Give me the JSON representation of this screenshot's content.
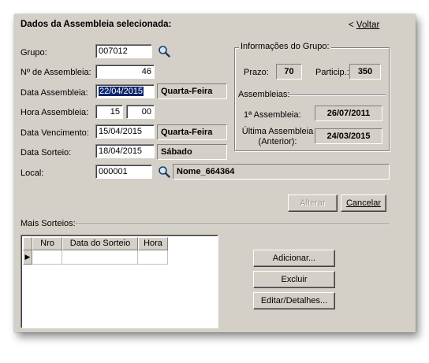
{
  "header": {
    "title": "Dados da Assembleia selecionada:",
    "back_chevron": "<",
    "back_label": "Voltar"
  },
  "form": {
    "grupo": {
      "label": "Grupo:",
      "value": "007012"
    },
    "numero": {
      "label": "Nº de Assembleia:",
      "value": "46"
    },
    "data_assembleia": {
      "label": "Data Assembleia:",
      "value": "22/04/2015",
      "weekday": "Quarta-Feira"
    },
    "hora": {
      "label": "Hora Assembleia:",
      "hour": "15",
      "minute": "00"
    },
    "data_vencimento": {
      "label": "Data Vencimento:",
      "value": "15/04/2015",
      "weekday": "Quarta-Feira"
    },
    "data_sorteio": {
      "label": "Data Sorteio:",
      "value": "18/04/2015",
      "weekday": "Sábado"
    },
    "local": {
      "label": "Local:",
      "value": "000001",
      "name": "Nome_664364"
    }
  },
  "grupo_info": {
    "title": "Informações do Grupo:",
    "prazo_label": "Prazo:",
    "prazo_value": "70",
    "particip_label": "Particip.:",
    "particip_value": "350",
    "assembleias_title": "Assembleias:",
    "primeira_label": "1ª Assembleia:",
    "primeira_value": "26/07/2011",
    "ultima_label_1": "Última Assembleia",
    "ultima_label_2": "(Anterior):",
    "ultima_value": "24/03/2015"
  },
  "actions": {
    "alterar": "Alterar",
    "cancelar": "Cancelar"
  },
  "sorteios": {
    "title": "Mais Sorteios:",
    "columns": [
      "Nro",
      "Data do Sorteio",
      "Hora"
    ],
    "row_indicator": "▶"
  },
  "side_buttons": {
    "adicionar": "Adicionar...",
    "excluir": "Excluir",
    "editar": "Editar/Detalhes..."
  },
  "icons": {
    "search": "search-icon",
    "row_pointer": "row-pointer-icon"
  },
  "colors": {
    "selection": "#0a246a",
    "panel": "#d4d0c8"
  }
}
